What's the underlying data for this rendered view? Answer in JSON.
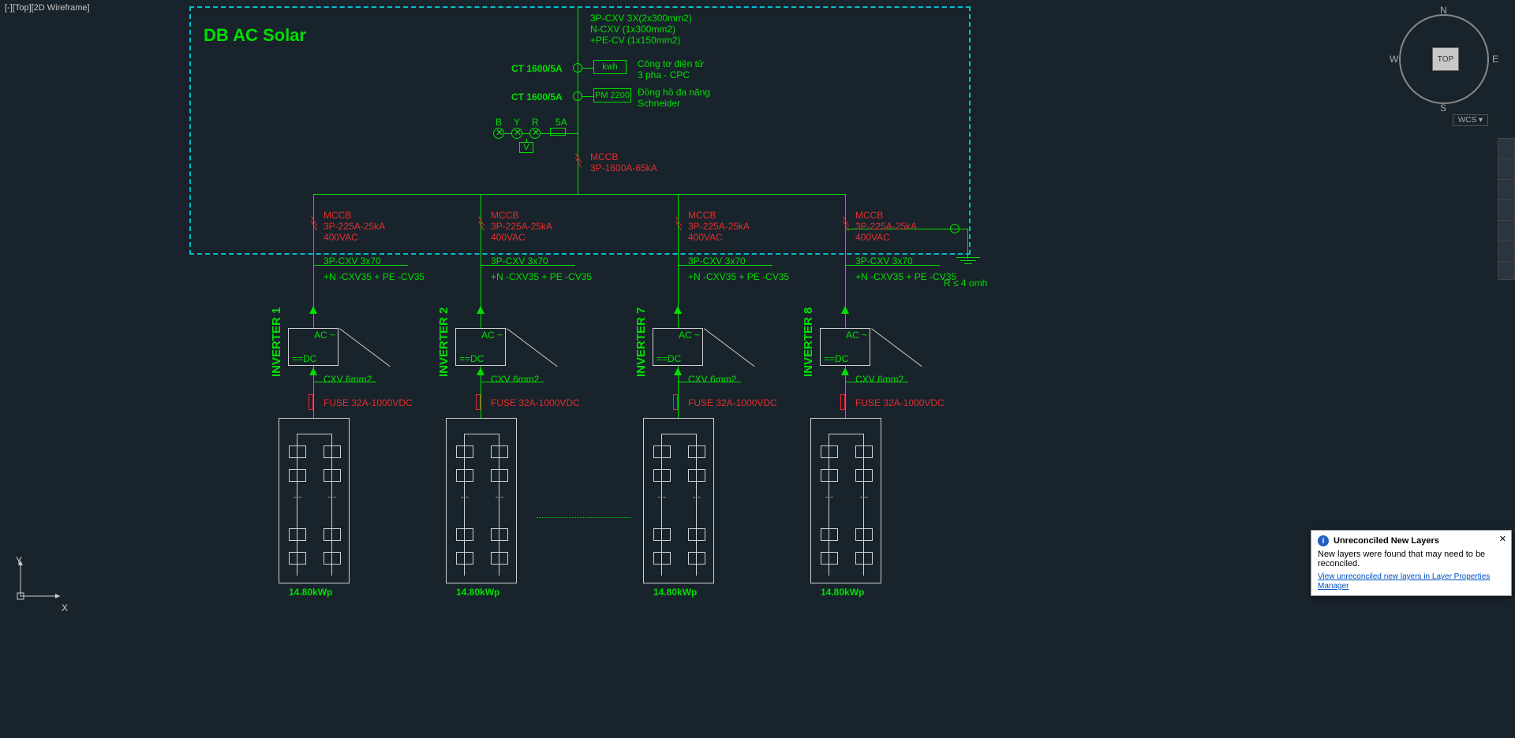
{
  "viewport_label": "[-][Top][2D Wireframe]",
  "panel_title": "DB AC Solar",
  "cable_main": {
    "l1": "3P-CXV 3X(2x300mm2)",
    "l2": "N-CXV (1x300mm2)",
    "l3": "+PE-CV (1x150mm2)"
  },
  "ct1_label": "CT 1600/5A",
  "ct2_label": "CT 1600/5A",
  "kwh_box": "kwh",
  "kwh_desc1": "Công tơ điện tử",
  "kwh_desc2": "3 pha - CPC",
  "pm_box": "PM 2200",
  "pm_desc1": "Đồng hồ đa năng",
  "pm_desc2": "Schneider",
  "phases": {
    "b": "B",
    "y": "Y",
    "r": "R",
    "amp": "5A",
    "v": "V"
  },
  "main_breaker": {
    "l1": "MCCB",
    "l2": "3P-1600A-65kA"
  },
  "branch_breaker": {
    "l1": "MCCB",
    "l2": "3P-225A-25kA",
    "l3": "400VAC"
  },
  "branch_cable": {
    "l1": "3P-CXV 3x70",
    "l2": "+N -CXV35 + PE -CV35"
  },
  "ground_note": "R ≤ 4 omh",
  "inverter": {
    "ac": "AC ~",
    "dc": "==DC"
  },
  "cxv": "CXV 6mm2",
  "fuse": "FUSE 32A-1000VDC",
  "kwp": "14.80kWp",
  "inverters": [
    "INVERTER 1",
    "INVERTER 2",
    "INVERTER 7",
    "INVERTER 8"
  ],
  "viewcube": {
    "top": "TOP",
    "n": "N",
    "s": "S",
    "e": "E",
    "w": "W",
    "wcs": "WCS ▾"
  },
  "ucs": {
    "x": "X",
    "y": "Y"
  },
  "notif": {
    "title": "Unreconciled New Layers",
    "body": "New layers were found that may need to be reconciled.",
    "link": "View unreconciled new layers in Layer Properties Manager"
  }
}
